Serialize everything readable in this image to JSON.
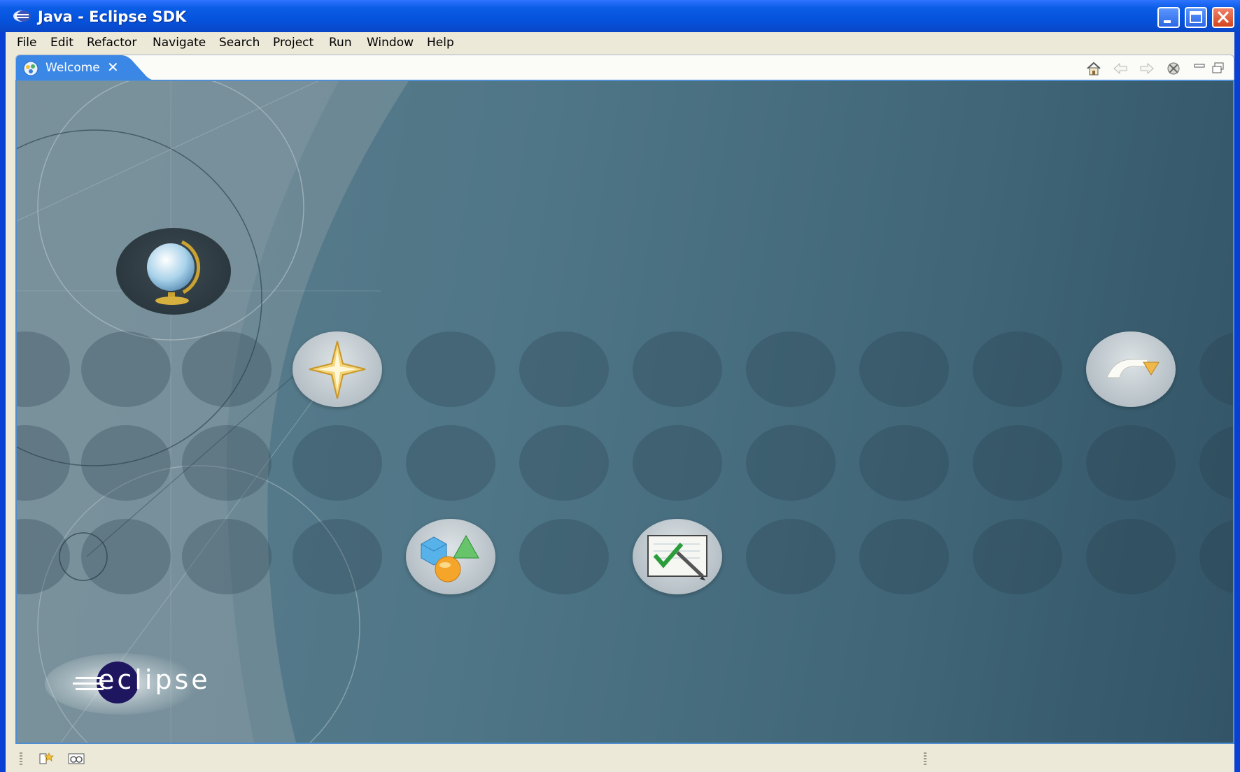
{
  "window": {
    "title": "Java - Eclipse SDK",
    "buttons": [
      "minimize",
      "maximize",
      "close"
    ]
  },
  "menubar": {
    "items": [
      "File",
      "Edit",
      "Refactor",
      "Navigate",
      "Search",
      "Project",
      "Run",
      "Window",
      "Help"
    ]
  },
  "welcome_view": {
    "tab_label": "Welcome",
    "tab_close": "✕",
    "toolbar_icons": [
      "home-icon",
      "back-arrow-icon",
      "forward-arrow-icon",
      "customize-icon",
      "minimize-view-icon",
      "maximize-view-icon"
    ],
    "circle_icons": [
      "globe-icon",
      "star-icon",
      "workbench-arrow-icon",
      "shapes-icon",
      "tutorials-icon"
    ],
    "logo": "eclipse"
  },
  "statusbar": {
    "icons": [
      "new-view-icon",
      "fast-view-icon"
    ]
  },
  "colors": {
    "title_bar": "#0553dd",
    "chrome": "#ece9d8",
    "welcome_bg": "#4f7687",
    "tab_active": "#3b87e6"
  }
}
